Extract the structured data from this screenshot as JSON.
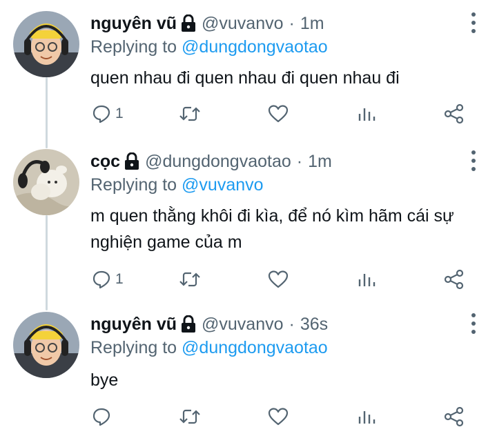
{
  "tweets": [
    {
      "name": "nguyên vũ",
      "handle": "@vuvanvo",
      "separator": "·",
      "time": "1m",
      "replying_prefix": "Replying to",
      "replying_to": "@dungdongvaotao",
      "text": "quen nhau đi quen nhau đi quen nhau đi",
      "reply_count": "1",
      "avatar": "person-with-yellow-beanie-headphones"
    },
    {
      "name": "cọc",
      "handle": "@dungdongvaotao",
      "separator": "·",
      "time": "1m",
      "replying_prefix": "Replying to",
      "replying_to": "@vuvanvo",
      "text": "m quen thằng khôi đi kìa, để nó kìm hãm cái sự nghiện game của m",
      "reply_count": "1",
      "avatar": "plush-toy-with-headphones"
    },
    {
      "name": "nguyên vũ",
      "handle": "@vuvanvo",
      "separator": "·",
      "time": "36s",
      "replying_prefix": "Replying to",
      "replying_to": "@dungdongvaotao",
      "text": "bye",
      "reply_count": "",
      "avatar": "person-with-yellow-beanie-headphones"
    }
  ],
  "icons": {
    "reply": "reply-icon",
    "retweet": "retweet-icon",
    "like": "heart-icon",
    "views": "analytics-icon",
    "share": "share-icon",
    "lock": "lock-icon",
    "more": "more-icon"
  },
  "colors": {
    "accent": "#1d9bf0",
    "muted": "#536471",
    "line": "#cfd9de"
  }
}
